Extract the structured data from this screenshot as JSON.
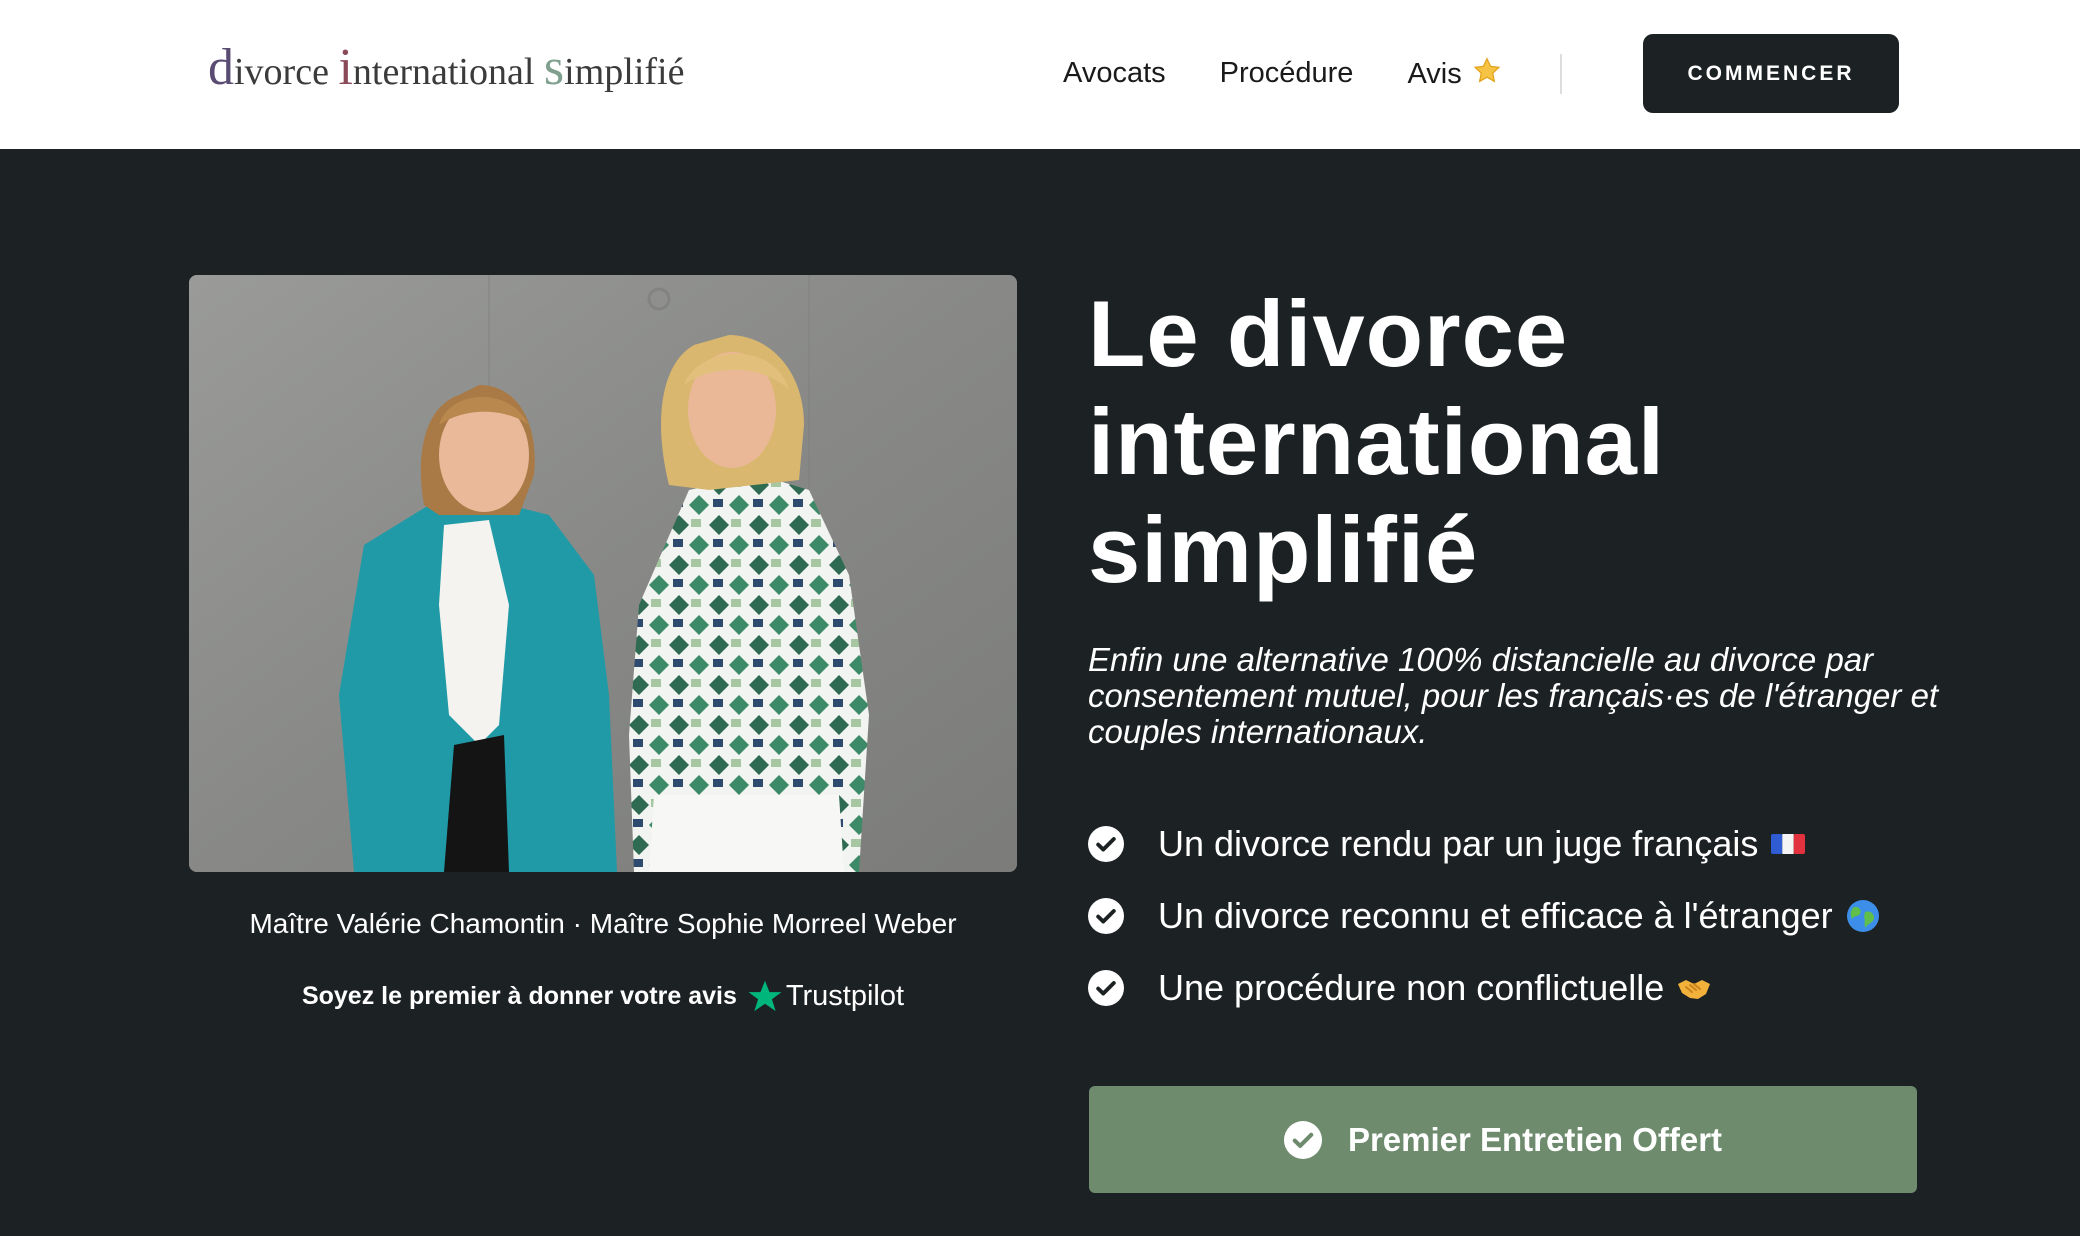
{
  "header": {
    "logo": {
      "w1_initial": "d",
      "w1_rest": "ivorce",
      "w2_initial": "i",
      "w2_rest": "nternational",
      "w3_initial": "s",
      "w3_rest": "implifié"
    },
    "nav": [
      {
        "label": "Avocats"
      },
      {
        "label": "Procédure"
      },
      {
        "label": "Avis",
        "icon": "star-icon"
      }
    ],
    "cta_label": "COMMENCER"
  },
  "hero": {
    "title_lines": [
      "Le divorce",
      "international",
      "simplifié"
    ],
    "subtitle": "Enfin une alternative 100% distancielle au divorce par consentement mutuel, pour les français·es de l'étranger et couples internationaux.",
    "features": [
      {
        "text": "Un divorce rendu par un juge français",
        "icon": "france-flag-icon"
      },
      {
        "text": "Un divorce reconnu et efficace à l'étranger",
        "icon": "globe-icon"
      },
      {
        "text": "Une procédure non conflictuelle",
        "icon": "handshake-icon"
      }
    ],
    "cta_label": "Premier Entretien Offert"
  },
  "photo": {
    "caption": "Maître Valérie Chamontin · Maître Sophie Morreel Weber"
  },
  "trust": {
    "text": "Soyez le premier à donner votre avis",
    "brand": "Trustpilot",
    "brand_color": "#00b67a"
  },
  "colors": {
    "header_bg": "#ffffff",
    "page_bg": "#1c2224",
    "cta_dark": "#1c2224",
    "cta_green": "#6e8b6d",
    "logo_d": "#5a4b73",
    "logo_i": "#8a4a58",
    "logo_s": "#7fa08e"
  }
}
